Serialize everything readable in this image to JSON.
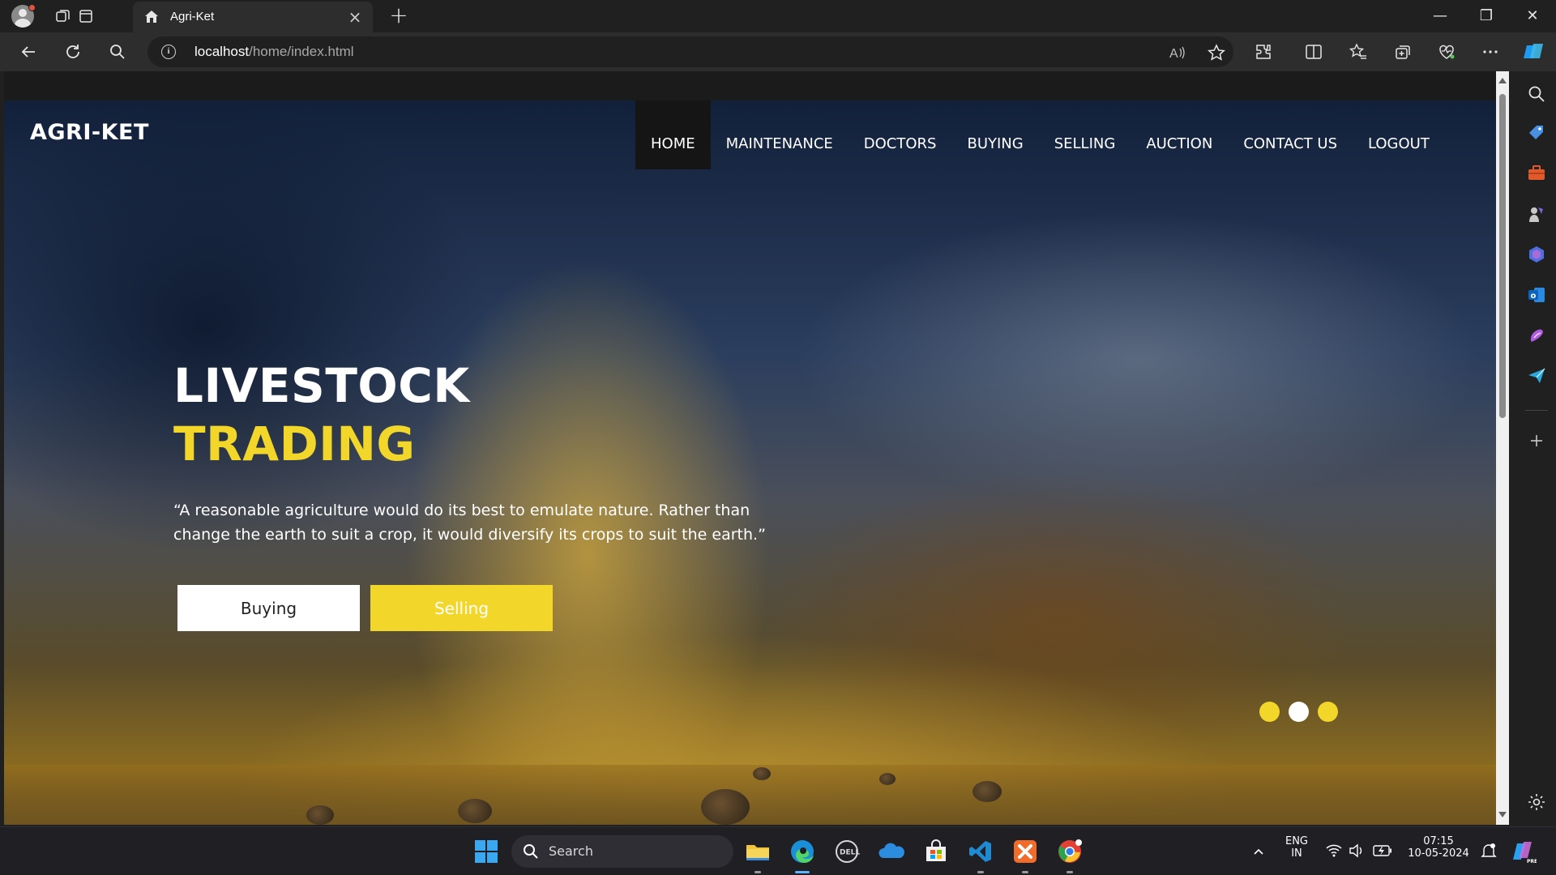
{
  "browser": {
    "tab_title": "Agri-Ket",
    "address_host": "localhost",
    "address_path": "/home/index.html",
    "window_controls": {
      "minimize": "—",
      "restore": "❐",
      "close": "✕"
    }
  },
  "site": {
    "brand": "AGRI-KET",
    "menu": [
      {
        "label": "HOME",
        "active": true
      },
      {
        "label": "MAINTENANCE",
        "active": false
      },
      {
        "label": "DOCTORS",
        "active": false
      },
      {
        "label": "BUYING",
        "active": false
      },
      {
        "label": "SELLING",
        "active": false
      },
      {
        "label": "AUCTION",
        "active": false
      },
      {
        "label": "CONTACT US",
        "active": false
      },
      {
        "label": "LOGOUT",
        "active": false
      }
    ],
    "hero": {
      "headline_line1": "LIVESTOCK",
      "headline_line2": "TRADING",
      "quote_line1": "“A reasonable agriculture would do its best to emulate nature. Rather than",
      "quote_line2": "change the earth to suit a crop, it would diversify its crops to suit the earth.”",
      "buy_button": "Buying",
      "sell_button": "Selling"
    },
    "carousel": {
      "count": 3,
      "active_index": 1
    },
    "colors": {
      "accent": "#f2d72a",
      "white": "#ffffff",
      "active_menu_bg": "#151515"
    }
  },
  "taskbar": {
    "search_label": "Search",
    "lang_line1": "ENG",
    "lang_line2": "IN",
    "time": "07:15",
    "date": "10-05-2024",
    "apps": [
      "start-icon",
      "file-explorer-icon",
      "edge-icon",
      "dell-icon",
      "onedrive-icon",
      "store-icon",
      "vscode-icon",
      "xampp-icon",
      "chrome-icon"
    ]
  }
}
